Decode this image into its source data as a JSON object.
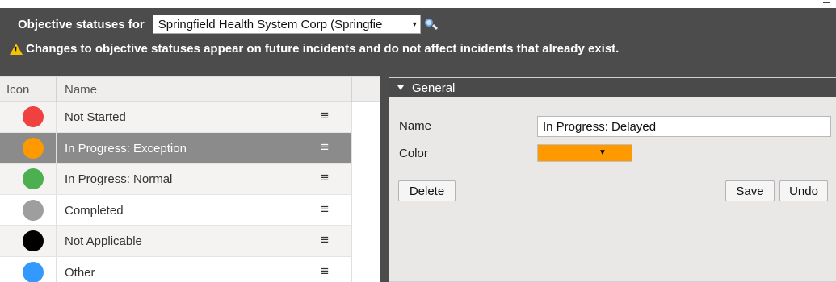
{
  "header": {
    "label": "Objective statuses for",
    "org_select": {
      "value": "Springfield Health System Corp (Springfie",
      "arrow": "▾"
    },
    "warning": "Changes to objective statuses appear on future incidents and do not affect incidents that already exist."
  },
  "grid": {
    "columns": [
      "Icon",
      "Name"
    ],
    "rows": [
      {
        "label": "Not Started",
        "color": "#f04040"
      },
      {
        "label": "In Progress: Exception",
        "color": "#ff9900",
        "selected": true
      },
      {
        "label": "In Progress: Normal",
        "color": "#4caf50"
      },
      {
        "label": "Completed",
        "color": "#9e9e9e"
      },
      {
        "label": "Not Applicable",
        "color": "#000000"
      },
      {
        "label": "Other",
        "color": "#3399ff"
      }
    ],
    "row_menu_icon": "≡"
  },
  "detail": {
    "section_title": "General",
    "name_label": "Name",
    "name_value": "In Progress: Delayed",
    "color_label": "Color",
    "color_value": "#ff9900",
    "buttons": {
      "delete": "Delete",
      "save": "Save",
      "undo": "Undo"
    }
  }
}
